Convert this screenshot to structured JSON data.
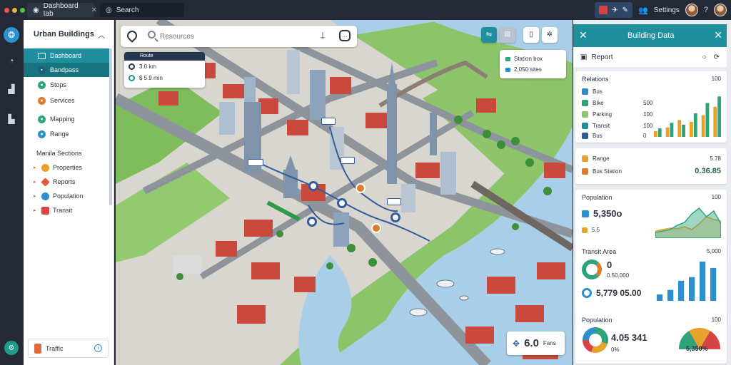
{
  "window": {
    "tabs": [
      {
        "label": "Dashboard tab"
      },
      {
        "label": "Search"
      }
    ],
    "user_label": "Settings",
    "accent": "#1f8f9e"
  },
  "sidebar": {
    "title": "Urban Buildings",
    "items": [
      {
        "label": "Dashboard",
        "icon": "layout-icon"
      },
      {
        "label": "Bandpass",
        "icon": "layers-icon"
      },
      {
        "label": "Stops",
        "icon": "stops-icon"
      },
      {
        "label": "Services",
        "icon": "services-icon"
      },
      {
        "label": "Mapping",
        "icon": "mapping-icon"
      },
      {
        "label": "Range",
        "icon": "range-icon"
      }
    ],
    "section_title": "Manila Sections",
    "sub_items": [
      {
        "label": "Properties",
        "color": "#e8a22b"
      },
      {
        "label": "Reports",
        "color": "#e05b3c"
      },
      {
        "label": "Population",
        "color": "#2e8fce"
      },
      {
        "label": "Transit",
        "color": "#d64545"
      }
    ],
    "footer": {
      "label": "Traffic"
    }
  },
  "map": {
    "search_placeholder": "Resources",
    "route_card": {
      "header": "Route",
      "rows": [
        {
          "label": "3.0 km"
        },
        {
          "label": "$ 5.9 min"
        }
      ]
    },
    "legend": [
      {
        "label": "Station box",
        "color": "#2fa37a"
      },
      {
        "label": "2,050 sites",
        "color": "#2e8fce"
      }
    ],
    "stat": {
      "value": "6.0",
      "unit": "Fans"
    },
    "pins": [
      {
        "label": "A"
      },
      {
        "label": "B"
      },
      {
        "label": "C"
      },
      {
        "label": "D"
      },
      {
        "label": "E"
      },
      {
        "label": "F"
      }
    ]
  },
  "panel": {
    "title": "Building Data",
    "subtitle": "Report",
    "card1": {
      "header": "Relations",
      "header_value": "100",
      "rows": [
        {
          "label": "Bus",
          "value": ""
        },
        {
          "label": "Bike",
          "value": "500"
        },
        {
          "label": "Parking",
          "value": "100"
        },
        {
          "label": "Transit",
          "value": "100"
        },
        {
          "label": "Bus",
          "value": "0"
        }
      ]
    },
    "card2": {
      "row1_label": "Range",
      "row1_value": "5.78",
      "row2_label": "Bus Station",
      "row2_value": "0.36.85"
    },
    "card3": {
      "header": "Population",
      "header_value": "100",
      "big": "5,350o",
      "small": "5.5"
    },
    "card4": {
      "header": "Transit Area",
      "header_value": "5,000",
      "big1": "0",
      "sub1": "0.50.000",
      "big2": "5,779 05.00"
    },
    "card5": {
      "header": "Population",
      "header_value": "100",
      "big": "4.05 341",
      "small": "0%",
      "gauge_label": "5,350%"
    }
  },
  "chart_data": [
    {
      "type": "bar",
      "categories": [
        "1",
        "2",
        "3",
        "4",
        "5",
        "6"
      ],
      "series": [
        {
          "values": [
            12,
            20,
            36,
            32,
            46,
            64
          ]
        },
        {
          "values": [
            18,
            30,
            26,
            50,
            72,
            86
          ]
        }
      ],
      "ylim": [
        0,
        100
      ],
      "colors": [
        "#e8a22b",
        "#2fa37a"
      ]
    },
    {
      "type": "area",
      "x": [
        0,
        1,
        2,
        3,
        4,
        5,
        6,
        7,
        8,
        9
      ],
      "series": [
        {
          "values": [
            10,
            12,
            14,
            13,
            16,
            12,
            20,
            30,
            26,
            24
          ]
        },
        {
          "values": [
            8,
            10,
            12,
            18,
            22,
            34,
            42,
            30,
            38,
            20
          ]
        }
      ],
      "colors": [
        "#e8a22b",
        "#2fa37a"
      ]
    },
    {
      "type": "bar",
      "categories": [
        "1",
        "2",
        "3",
        "4",
        "5",
        "6"
      ],
      "values": [
        14,
        24,
        44,
        52,
        86,
        72
      ],
      "ylim": [
        0,
        100
      ],
      "colors": [
        "#2e8fce"
      ]
    },
    {
      "type": "pie",
      "values": [
        30,
        25,
        20,
        25
      ],
      "colors": [
        "#2fa37a",
        "#e8a22b",
        "#d64545",
        "#2e8fce"
      ]
    }
  ]
}
